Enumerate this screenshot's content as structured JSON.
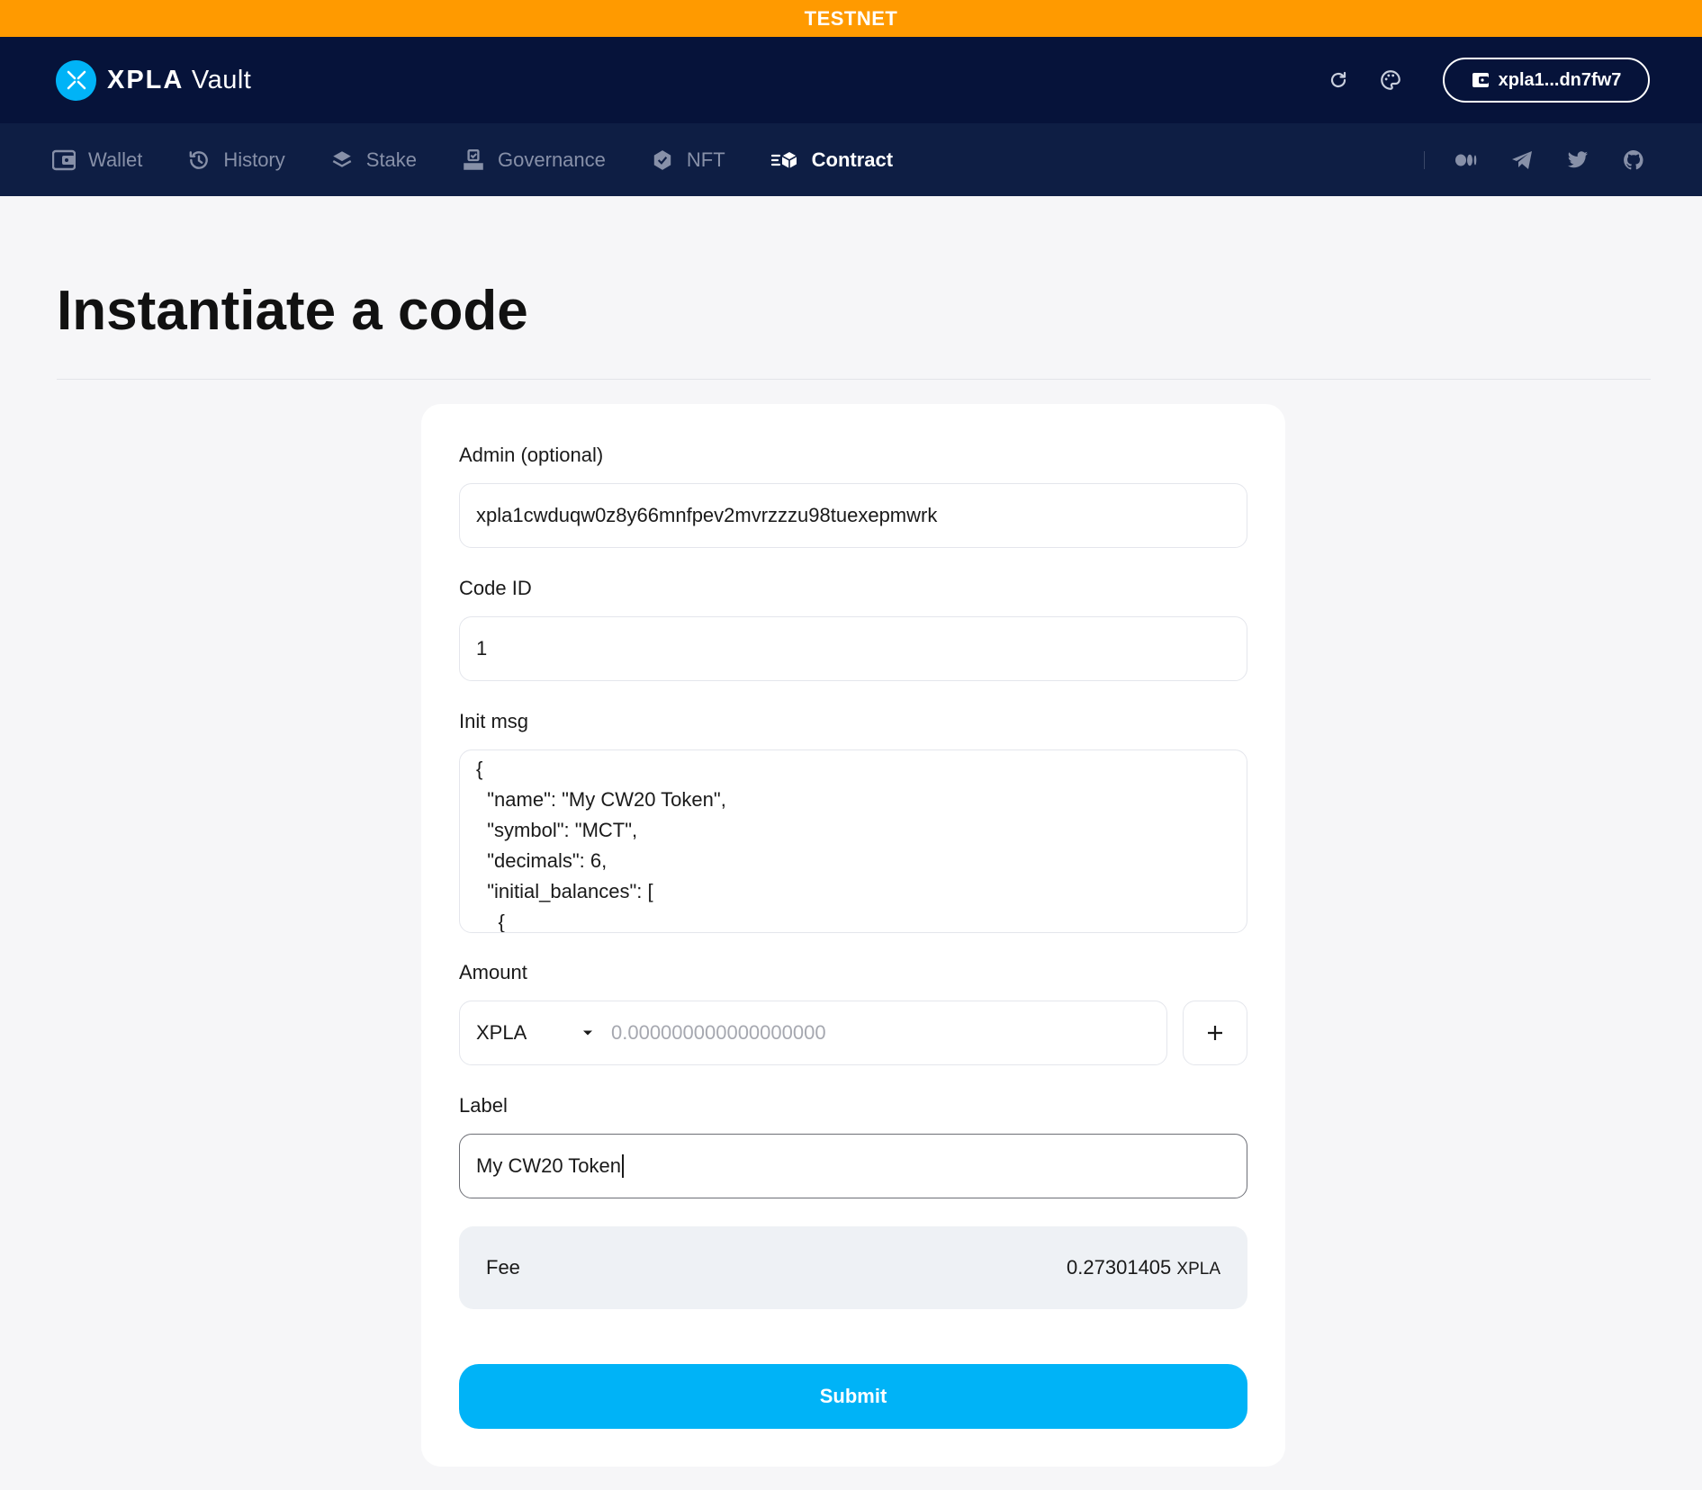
{
  "banner": {
    "text": "TESTNET"
  },
  "header": {
    "logo_brand": "XPLA",
    "logo_suffix": "Vault",
    "wallet_address": "xpla1...dn7fw7"
  },
  "nav": {
    "items": [
      {
        "label": "Wallet",
        "icon": "wallet-icon"
      },
      {
        "label": "History",
        "icon": "history-icon"
      },
      {
        "label": "Stake",
        "icon": "stake-icon"
      },
      {
        "label": "Governance",
        "icon": "governance-icon"
      },
      {
        "label": "NFT",
        "icon": "nft-icon"
      },
      {
        "label": "Contract",
        "icon": "contract-icon",
        "active": true
      }
    ],
    "social": [
      "medium-icon",
      "telegram-icon",
      "twitter-icon",
      "github-icon"
    ]
  },
  "page": {
    "title": "Instantiate a code"
  },
  "form": {
    "admin_label": "Admin (optional)",
    "admin_value": "xpla1cwduqw0z8y66mnfpev2mvrzzzu98tuexepmwrk",
    "code_id_label": "Code ID",
    "code_id_value": "1",
    "init_msg_label": "Init msg",
    "init_msg_value": "{\n  \"name\": \"My CW20 Token\",\n  \"symbol\": \"MCT\",\n  \"decimals\": 6,\n  \"initial_balances\": [\n    {",
    "amount_label": "Amount",
    "amount_denom": "XPLA",
    "amount_placeholder": "0.000000000000000000",
    "label_label": "Label",
    "label_value": "My CW20 Token",
    "fee_label": "Fee",
    "fee_amount": "0.27301405",
    "fee_unit": "XPLA",
    "submit_label": "Submit"
  },
  "colors": {
    "banner": "#ff9a00",
    "header_bg": "#06133a",
    "nav_bg": "#0e1e44",
    "accent": "#00b3f7",
    "fee_bg": "#eef1f5"
  }
}
